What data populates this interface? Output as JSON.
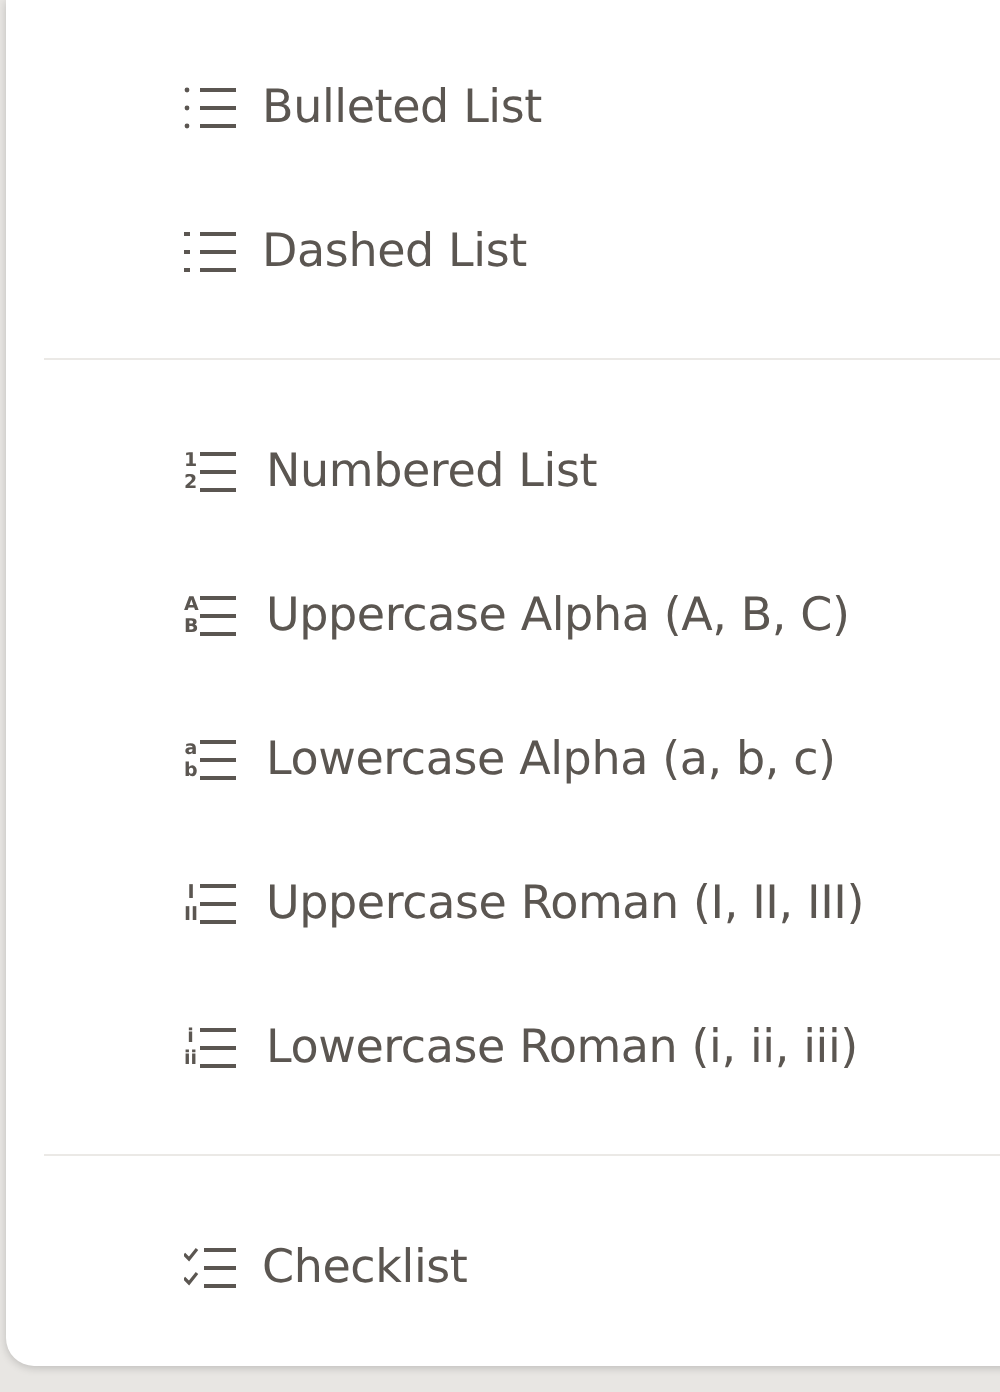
{
  "menu": {
    "sections": [
      {
        "items": [
          {
            "label": "Bulleted List",
            "kind": "dots"
          },
          {
            "label": "Dashed List",
            "kind": "dashes"
          }
        ]
      },
      {
        "items": [
          {
            "label": "Numbered List",
            "kind": "markers",
            "markers": [
              "1",
              "2"
            ]
          },
          {
            "label": "Uppercase Alpha (A, B, C)",
            "kind": "markers",
            "markers": [
              "A",
              "B"
            ]
          },
          {
            "label": "Lowercase Alpha (a, b, c)",
            "kind": "markers",
            "markers": [
              "a",
              "b"
            ]
          },
          {
            "label": "Uppercase Roman (I, II, III)",
            "kind": "markers",
            "markers": [
              "I",
              "II"
            ]
          },
          {
            "label": "Lowercase Roman (i, ii, iii)",
            "kind": "markers",
            "markers": [
              "i",
              "ii"
            ]
          }
        ]
      },
      {
        "items": [
          {
            "label": "Checklist",
            "kind": "checks"
          }
        ]
      }
    ]
  }
}
